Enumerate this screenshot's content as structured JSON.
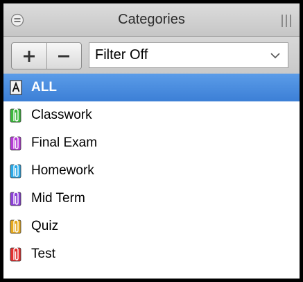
{
  "panel": {
    "title": "Categories",
    "collapse_icon": "collapse-circle-icon",
    "grip_icon": "column-grip-icon"
  },
  "toolbar": {
    "add_icon": "plus-icon",
    "remove_icon": "minus-icon",
    "filter_value": "Filter Off",
    "filter_chevron_icon": "chevron-down-icon"
  },
  "categories": {
    "items": [
      {
        "label": "ALL",
        "icon": "all-a-icon",
        "color": "#ffffff",
        "selected": true
      },
      {
        "label": "Classwork",
        "icon": "green-clip-icon",
        "color": "#3cb83c",
        "selected": false
      },
      {
        "label": "Final Exam",
        "icon": "violet-clip-icon",
        "color": "#b53bd6",
        "selected": false
      },
      {
        "label": "Homework",
        "icon": "cyan-clip-icon",
        "color": "#2aa8e6",
        "selected": false
      },
      {
        "label": "Mid Term",
        "icon": "purple-clip-icon",
        "color": "#8c3fd6",
        "selected": false
      },
      {
        "label": "Quiz",
        "icon": "yellow-clip-icon",
        "color": "#e6a91e",
        "selected": false
      },
      {
        "label": "Test",
        "icon": "red-clip-icon",
        "color": "#e23030",
        "selected": false
      }
    ]
  },
  "colors": {
    "selection": "#4a8ee0",
    "header_bg": "#d0d0d0"
  }
}
